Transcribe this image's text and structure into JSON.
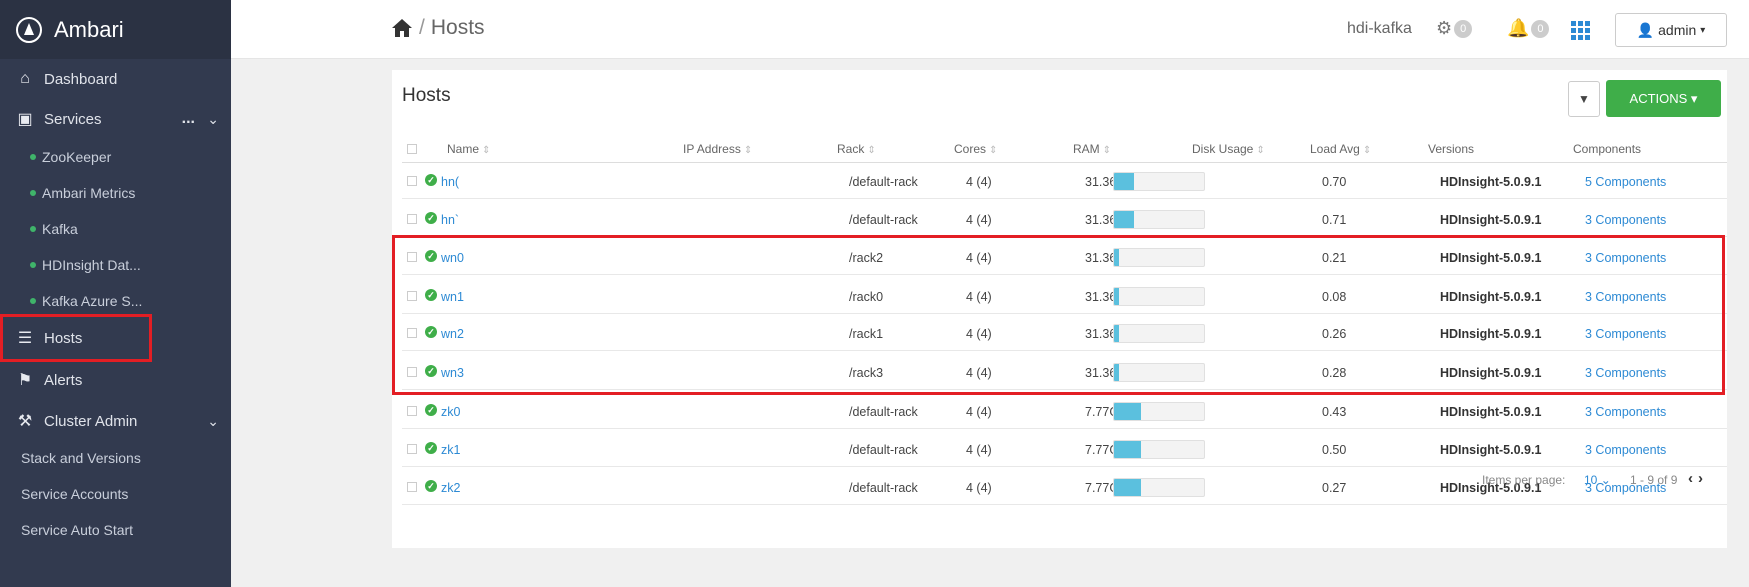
{
  "sidebar": {
    "brand": "Ambari",
    "items": [
      {
        "label": "Dashboard",
        "icon": "home-icon"
      },
      {
        "label": "Services",
        "icon": "briefcase-icon",
        "more": "...",
        "chevron": "chevron-down-icon"
      },
      {
        "label": "Hosts",
        "icon": "server-icon"
      },
      {
        "label": "Alerts",
        "icon": "bell-icon"
      },
      {
        "label": "Cluster Admin",
        "icon": "wrench-icon",
        "chevron": "chevron-down-icon"
      }
    ],
    "services": [
      "ZooKeeper",
      "Ambari Metrics",
      "Kafka",
      "HDInsight Dat...",
      "Kafka Azure S..."
    ],
    "cluster_admin": [
      "Stack and Versions",
      "Service Accounts",
      "Service Auto Start"
    ]
  },
  "topbar": {
    "breadcrumb_sep": "/",
    "breadcrumb_page": "Hosts",
    "cluster": "hdi-kafka",
    "ops_count": "0",
    "alerts_count": "0",
    "user": "admin"
  },
  "panel": {
    "title": "Hosts",
    "actions_label": "ACTIONS ▾",
    "columns": [
      "Name",
      "IP Address",
      "Rack",
      "Cores",
      "RAM",
      "Disk Usage",
      "Load Avg",
      "Versions",
      "Components"
    ],
    "rows": [
      {
        "name": "hn(",
        "rack": "/default-rack",
        "cores": "4 (4)",
        "ram": "31.36GB",
        "disk": 0.22,
        "load": "0.70",
        "version": "HDInsight-5.0.9.1",
        "components": "5 Components"
      },
      {
        "name": "hn`",
        "rack": "/default-rack",
        "cores": "4 (4)",
        "ram": "31.36GB",
        "disk": 0.22,
        "load": "0.71",
        "version": "HDInsight-5.0.9.1",
        "components": "3 Components"
      },
      {
        "name": "wn0",
        "rack": "/rack2",
        "cores": "4 (4)",
        "ram": "31.36GB",
        "disk": 0.05,
        "load": "0.21",
        "version": "HDInsight-5.0.9.1",
        "components": "3 Components"
      },
      {
        "name": "wn1",
        "rack": "/rack0",
        "cores": "4 (4)",
        "ram": "31.36GB",
        "disk": 0.05,
        "load": "0.08",
        "version": "HDInsight-5.0.9.1",
        "components": "3 Components"
      },
      {
        "name": "wn2",
        "rack": "/rack1",
        "cores": "4 (4)",
        "ram": "31.36GB",
        "disk": 0.05,
        "load": "0.26",
        "version": "HDInsight-5.0.9.1",
        "components": "3 Components"
      },
      {
        "name": "wn3",
        "rack": "/rack3",
        "cores": "4 (4)",
        "ram": "31.36GB",
        "disk": 0.05,
        "load": "0.28",
        "version": "HDInsight-5.0.9.1",
        "components": "3 Components"
      },
      {
        "name": "zk0",
        "rack": "/default-rack",
        "cores": "4 (4)",
        "ram": "7.77GB",
        "disk": 0.3,
        "load": "0.43",
        "version": "HDInsight-5.0.9.1",
        "components": "3 Components"
      },
      {
        "name": "zk1",
        "rack": "/default-rack",
        "cores": "4 (4)",
        "ram": "7.77GB",
        "disk": 0.3,
        "load": "0.50",
        "version": "HDInsight-5.0.9.1",
        "components": "3 Components"
      },
      {
        "name": "zk2",
        "rack": "/default-rack",
        "cores": "4 (4)",
        "ram": "7.77GB",
        "disk": 0.3,
        "load": "0.27",
        "version": "HDInsight-5.0.9.1",
        "components": "3 Components"
      }
    ],
    "pager": {
      "label": "Items per page:",
      "per_page": "10",
      "range": "1 - 9 of 9"
    }
  },
  "colors": {
    "sidebar": "#323a4f",
    "accent": "#2d8ad4",
    "success": "#3fae49",
    "highlight": "#e31e24"
  }
}
